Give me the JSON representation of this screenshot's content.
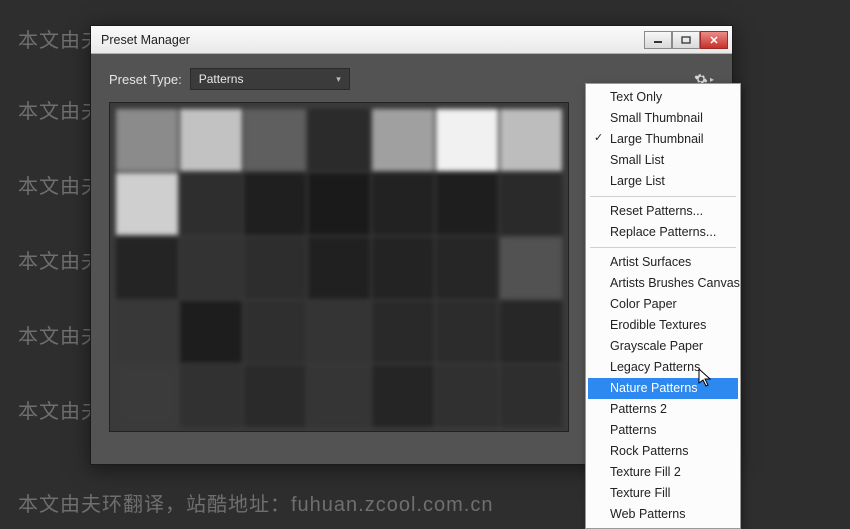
{
  "watermark_text": "本文由夫环翻译，站酷地址：fuhuan.zcool.com.cn",
  "dialog": {
    "title": "Preset Manager",
    "preset_type_label": "Preset Type:",
    "preset_type_value": "Patterns"
  },
  "swatch_colors": [
    "#8b8b8b",
    "#c2c2c2",
    "#5f5f5f",
    "#2b2b2b",
    "#a0a0a0",
    "#f1f1f1",
    "#bdbdbd",
    "#cfcfcf",
    "#2e2e2e",
    "#1f1f1f",
    "#1a1a1a",
    "#222222",
    "#1e1e1e",
    "#2a2a2a",
    "#242424",
    "#333333",
    "#2d2d2d",
    "#202020",
    "#232323",
    "#262626",
    "#525252",
    "#383838",
    "#1d1d1d",
    "#2f2f2f",
    "#343434",
    "#292929",
    "#2c2c2c",
    "#272727",
    "#3b3b3b",
    "#313131",
    "#2a2a2a",
    "#353535",
    "#252525",
    "#303030",
    "#2e2e2e"
  ],
  "menu": {
    "groups": [
      {
        "items": [
          {
            "label": "Text Only",
            "checked": false
          },
          {
            "label": "Small Thumbnail",
            "checked": false
          },
          {
            "label": "Large Thumbnail",
            "checked": true
          },
          {
            "label": "Small List",
            "checked": false
          },
          {
            "label": "Large List",
            "checked": false
          }
        ]
      },
      {
        "items": [
          {
            "label": "Reset Patterns...",
            "checked": false
          },
          {
            "label": "Replace Patterns...",
            "checked": false
          }
        ]
      },
      {
        "items": [
          {
            "label": "Artist Surfaces",
            "checked": false
          },
          {
            "label": "Artists Brushes Canvas",
            "checked": false
          },
          {
            "label": "Color Paper",
            "checked": false
          },
          {
            "label": "Erodible Textures",
            "checked": false
          },
          {
            "label": "Grayscale Paper",
            "checked": false
          },
          {
            "label": "Legacy Patterns",
            "checked": false
          },
          {
            "label": "Nature Patterns",
            "checked": false,
            "highlight": true
          },
          {
            "label": "Patterns 2",
            "checked": false
          },
          {
            "label": "Patterns",
            "checked": false
          },
          {
            "label": "Rock Patterns",
            "checked": false
          },
          {
            "label": "Texture Fill 2",
            "checked": false
          },
          {
            "label": "Texture Fill",
            "checked": false
          },
          {
            "label": "Web Patterns",
            "checked": false
          }
        ]
      }
    ]
  }
}
